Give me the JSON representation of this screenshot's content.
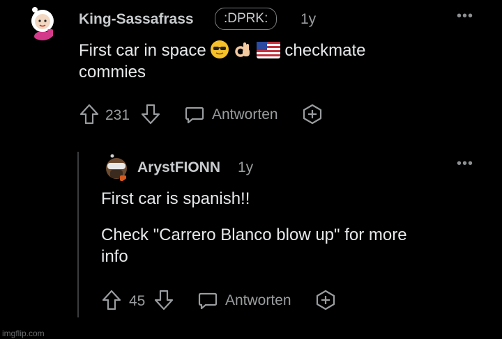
{
  "comment1": {
    "username": "King-Sassafrass",
    "flair": ":DPRK:",
    "age": "1y",
    "text_before_emojis": "First car in space",
    "emojis": [
      "sunglasses-face",
      "ok-hand",
      "us-flag"
    ],
    "text_after_emojis": "checkmate",
    "text_line2": "commies",
    "score": "231",
    "reply_label": "Antworten"
  },
  "comment2": {
    "username": "ArystFIONN",
    "age": "1y",
    "paragraph1": "First car is spanish!!",
    "paragraph2_line1": "Check \"Carrero Blanco blow up\" for more",
    "paragraph2_line2": "info",
    "score": "45",
    "reply_label": "Antworten"
  },
  "more_menu_glyph": "•••",
  "watermark": "imgflip.com"
}
